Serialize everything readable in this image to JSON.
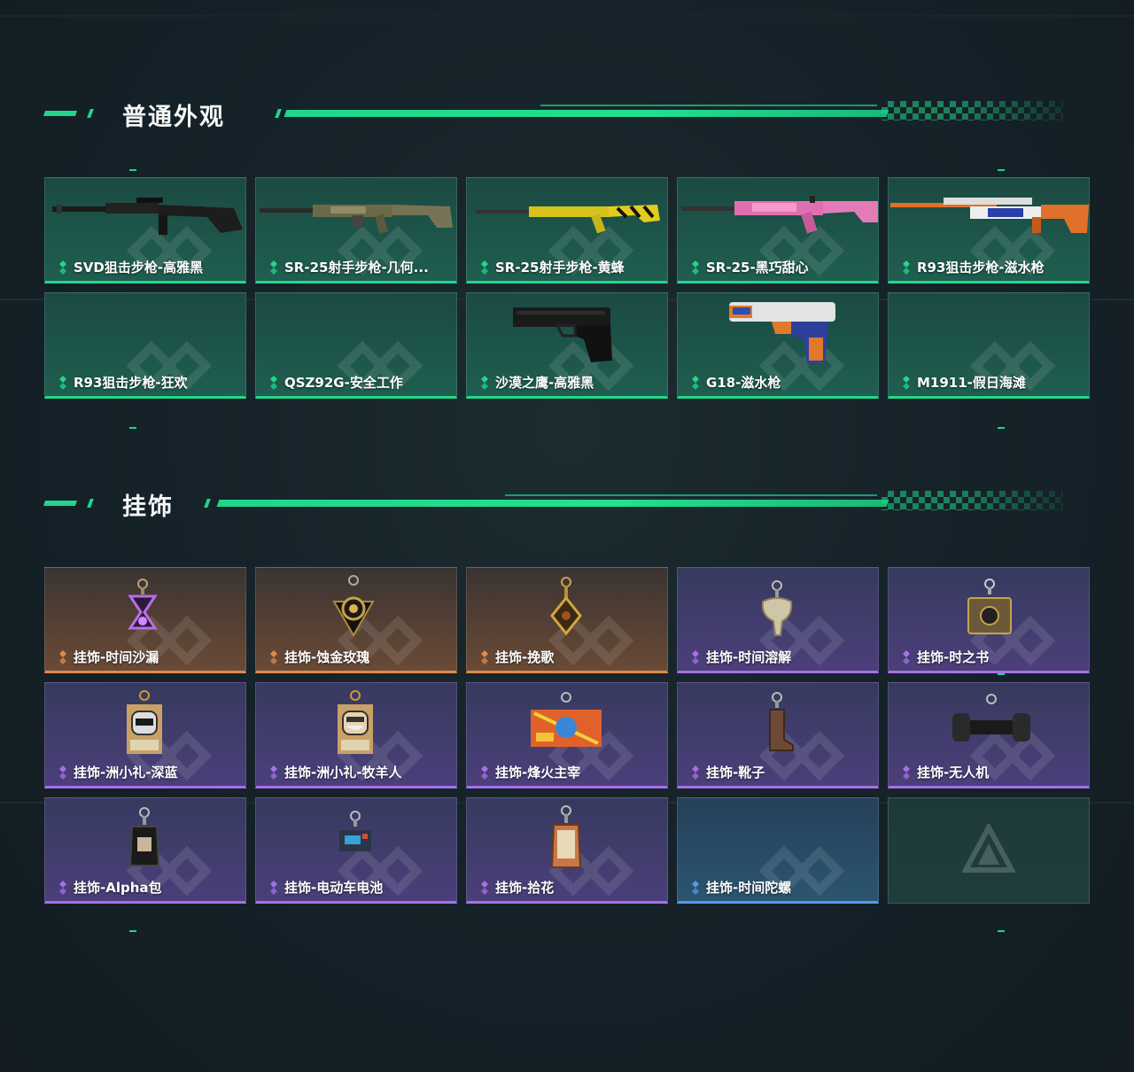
{
  "sections": {
    "skins": {
      "title": "普通外观",
      "items": [
        {
          "label": "SVD狙击步枪-高雅黑",
          "rarity": "green",
          "icon": "svd-sniper-rifle-black"
        },
        {
          "label": "SR-25射手步枪-几何...",
          "rarity": "green",
          "icon": "sr25-rifle-geometric-camo"
        },
        {
          "label": "SR-25射手步枪-黄蜂",
          "rarity": "green",
          "icon": "sr25-rifle-yellow-hornet"
        },
        {
          "label": "SR-25-黑巧甜心",
          "rarity": "green",
          "icon": "sr25-rifle-pink"
        },
        {
          "label": "R93狙击步枪-滋水枪",
          "rarity": "green",
          "icon": "r93-sniper-water-gun"
        },
        {
          "label": "R93狙击步枪-狂欢",
          "rarity": "green",
          "icon": ""
        },
        {
          "label": "QSZ92G-安全工作",
          "rarity": "green",
          "icon": ""
        },
        {
          "label": "沙漠之鹰-高雅黑",
          "rarity": "green",
          "icon": "desert-eagle-pistol-black"
        },
        {
          "label": "G18-滋水枪",
          "rarity": "green",
          "icon": "g18-pistol-water-gun"
        },
        {
          "label": "M1911-假日海滩",
          "rarity": "green",
          "icon": ""
        }
      ]
    },
    "charms": {
      "title": "挂饰",
      "items": [
        {
          "label": "挂饰-时间沙漏",
          "rarity": "orange",
          "icon": "hourglass-charm"
        },
        {
          "label": "挂饰-蚀金玫瑰",
          "rarity": "orange",
          "icon": "gold-rose-charm"
        },
        {
          "label": "挂饰-挽歌",
          "rarity": "orange",
          "icon": "elegy-charm"
        },
        {
          "label": "挂饰-时间溶解",
          "rarity": "purple",
          "icon": "melting-clock-charm"
        },
        {
          "label": "挂饰-时之书",
          "rarity": "purple",
          "icon": "book-charm"
        },
        {
          "label": "挂饰-洲小礼-深蓝",
          "rarity": "purple",
          "icon": "gift-box-blue-charm"
        },
        {
          "label": "挂饰-洲小礼-牧羊人",
          "rarity": "purple",
          "icon": "gift-box-shepherd-charm"
        },
        {
          "label": "挂饰-烽火主宰",
          "rarity": "purple",
          "icon": "container-charm"
        },
        {
          "label": "挂饰-靴子",
          "rarity": "purple",
          "icon": "boot-charm"
        },
        {
          "label": "挂饰-无人机",
          "rarity": "purple",
          "icon": "drone-charm"
        },
        {
          "label": "挂饰-Alpha包",
          "rarity": "purple",
          "icon": "alpha-bag-charm"
        },
        {
          "label": "挂饰-电动车电池",
          "rarity": "purple",
          "icon": "battery-charm"
        },
        {
          "label": "挂饰-拾花",
          "rarity": "purple",
          "icon": "flower-tag-charm"
        },
        {
          "label": "挂饰-时间陀螺",
          "rarity": "blue",
          "icon": ""
        },
        {
          "label": "",
          "rarity": "empty",
          "icon": "delta-logo"
        }
      ]
    }
  },
  "colors": {
    "accent": "#1fd68a",
    "green": "#21d889",
    "orange": "#e08a4a",
    "purple": "#a670e8",
    "blue": "#4f9be6"
  }
}
